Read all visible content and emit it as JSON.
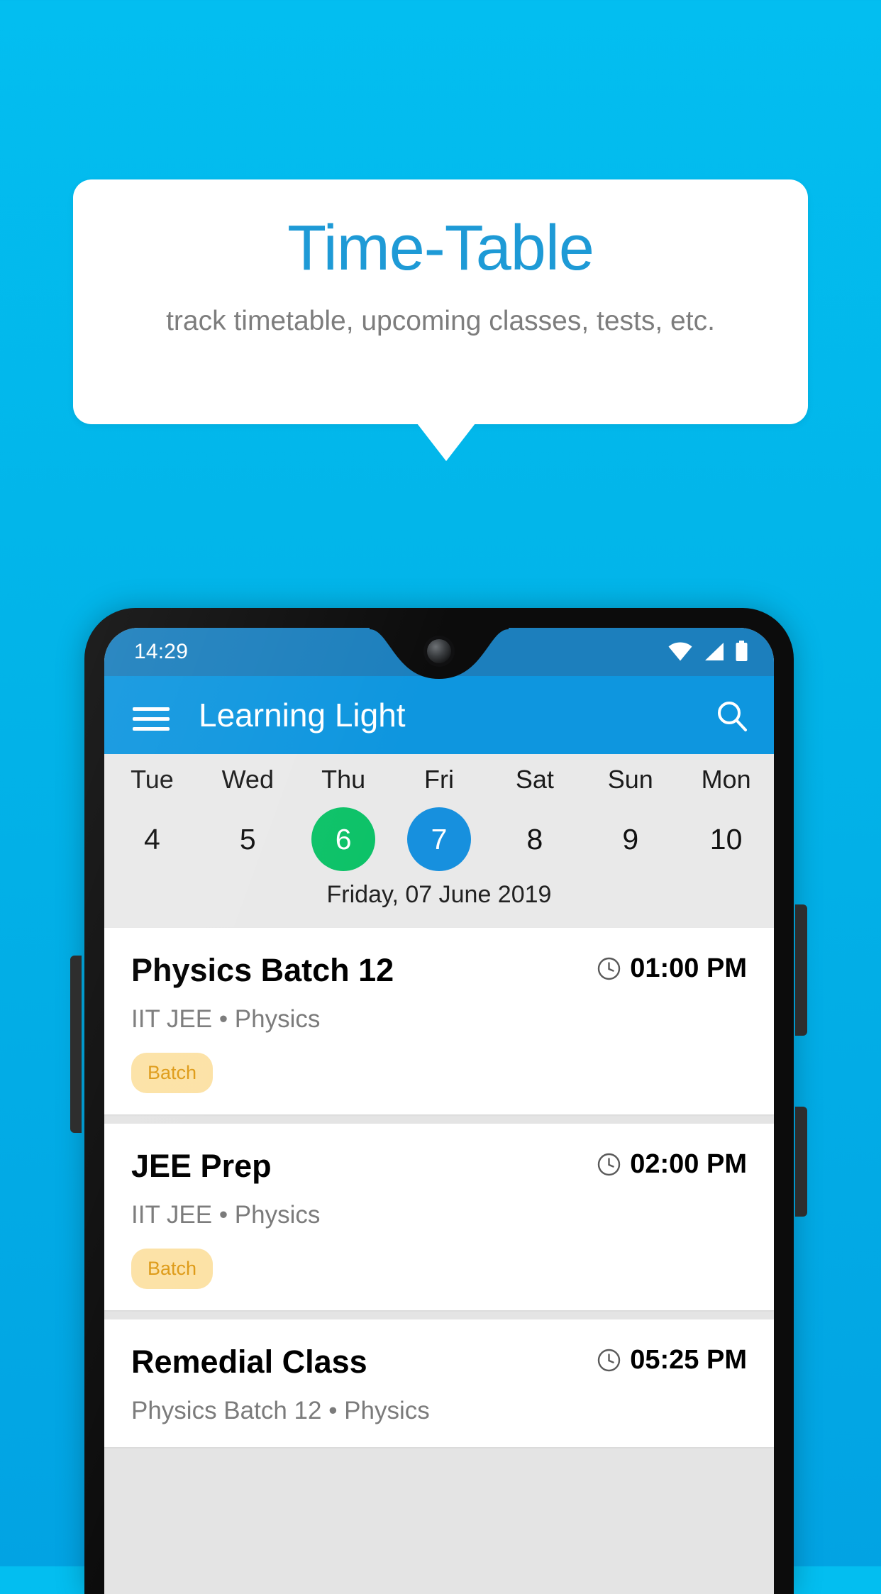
{
  "background": {
    "top_color": "#03BEF0",
    "bottom_color": "#02A3E3"
  },
  "promo": {
    "title": "Time-Table",
    "subtitle": "track timetable, upcoming classes, tests, etc.",
    "title_color": "#1E9AD6",
    "subtitle_color": "#7d7d7d",
    "card_color": "#ffffff"
  },
  "phone": {
    "status_bar": {
      "time": "14:29",
      "background_color": "#1C7FBD",
      "icons": [
        "wifi-icon",
        "cellular-signal-icon",
        "battery-icon"
      ]
    },
    "app_bar": {
      "menu_icon": "hamburger-menu-icon",
      "title": "Learning Light",
      "search_icon": "search-icon",
      "background_color": "#0E96DF"
    },
    "date_strip": {
      "background_color": "#E9E9E9",
      "today_color": "#0DC268",
      "selected_color": "#1790DE",
      "days": [
        {
          "name": "Tue",
          "date": "4",
          "state": "normal"
        },
        {
          "name": "Wed",
          "date": "5",
          "state": "normal"
        },
        {
          "name": "Thu",
          "date": "6",
          "state": "today"
        },
        {
          "name": "Fri",
          "date": "7",
          "state": "selected"
        },
        {
          "name": "Sat",
          "date": "8",
          "state": "normal"
        },
        {
          "name": "Sun",
          "date": "9",
          "state": "normal"
        },
        {
          "name": "Mon",
          "date": "10",
          "state": "normal"
        }
      ],
      "full_date": "Friday, 07 June 2019"
    },
    "schedule": {
      "badge_bg": "#FCE2A6",
      "badge_fg": "#DE9B18",
      "items": [
        {
          "title": "Physics Batch 12",
          "time": "01:00 PM",
          "time_icon": "clock-icon",
          "subtitle": "IIT JEE • Physics",
          "badge": "Batch"
        },
        {
          "title": "JEE Prep",
          "time": "02:00 PM",
          "time_icon": "clock-icon",
          "subtitle": "IIT JEE • Physics",
          "badge": "Batch"
        },
        {
          "title": "Remedial Class",
          "time": "05:25 PM",
          "time_icon": "clock-icon",
          "subtitle": "Physics Batch 12 • Physics",
          "badge": ""
        }
      ]
    }
  }
}
